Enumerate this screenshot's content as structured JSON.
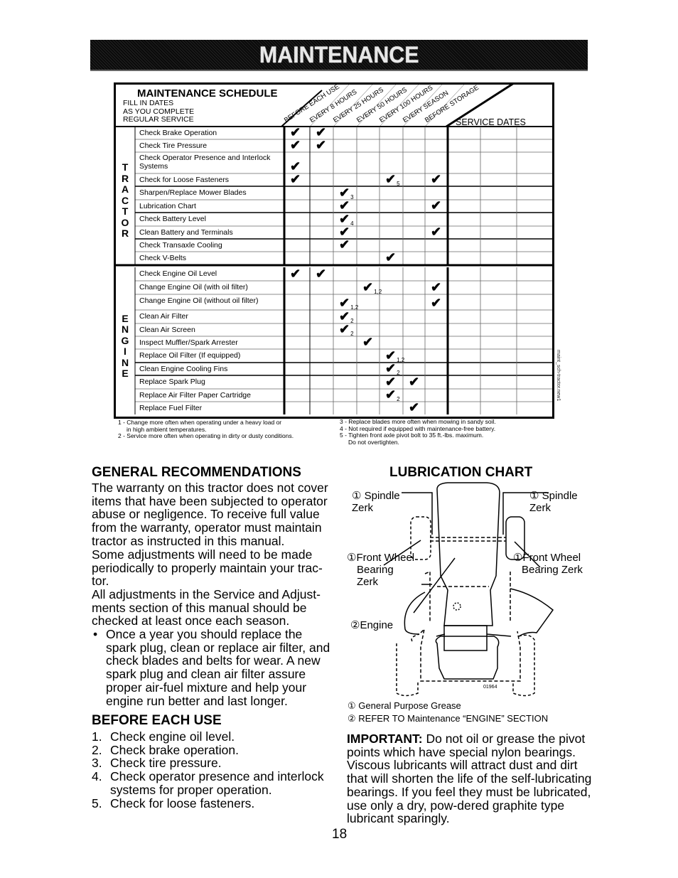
{
  "banner": {
    "title": "MAINTENANCE"
  },
  "schedule": {
    "title": "MAINTENANCE SCHEDULE",
    "subtitle_lines": [
      "FILL IN DATES",
      "AS YOU COMPLETE",
      "REGULAR SERVICE"
    ],
    "columns": [
      "BEFORE EACH USE",
      "EVERY 8 HOURS",
      "EVERY 25 HOURS",
      "EVERY 50 HOURS",
      "EVERY 100 HOURS",
      "EVERY SEASON",
      "BEFORE STORAGE"
    ],
    "service_dates_label": "SERVICE DATES",
    "service_date_columns": 3,
    "sections": [
      {
        "label": "TRACTOR",
        "tasks": [
          {
            "name": "Check Brake Operation",
            "checks": [
              {
                "col": 0
              },
              {
                "col": 1
              }
            ]
          },
          {
            "name": "Check Tire Pressure",
            "checks": [
              {
                "col": 0
              },
              {
                "col": 1
              }
            ]
          },
          {
            "name": "Check Operator Presence and Interlock Systems",
            "checks": [
              {
                "col": 0
              }
            ]
          },
          {
            "name": "Check for Loose Fasteners",
            "checks": [
              {
                "col": 0
              },
              {
                "col": 4,
                "note": "5"
              },
              {
                "col": 6
              }
            ]
          },
          {
            "name": "Sharpen/Replace Mower Blades",
            "checks": [
              {
                "col": 2,
                "note": "3"
              }
            ]
          },
          {
            "name": "Lubrication Chart",
            "checks": [
              {
                "col": 2
              },
              {
                "col": 6
              }
            ]
          },
          {
            "name": "Check Battery Level",
            "checks": [
              {
                "col": 2,
                "note": "4"
              }
            ]
          },
          {
            "name": "Clean Battery and Terminals",
            "checks": [
              {
                "col": 2
              },
              {
                "col": 6
              }
            ]
          },
          {
            "name": "Check Transaxle Cooling",
            "checks": [
              {
                "col": 2
              }
            ]
          },
          {
            "name": "Check V-Belts",
            "checks": [
              {
                "col": 4
              }
            ]
          }
        ]
      },
      {
        "label": "ENGINE",
        "tasks": [
          {
            "name": "Check Engine Oil Level",
            "checks": [
              {
                "col": 0
              },
              {
                "col": 1
              }
            ]
          },
          {
            "name": "Change Engine Oil (with oil filter)",
            "checks": [
              {
                "col": 3,
                "note": "1,2"
              },
              {
                "col": 6
              }
            ]
          },
          {
            "name": "Change Engine Oil (without oil filter)",
            "checks": [
              {
                "col": 2,
                "note": "1,2"
              },
              {
                "col": 6
              }
            ]
          },
          {
            "name": "Clean Air Filter",
            "checks": [
              {
                "col": 2,
                "note": "2"
              }
            ]
          },
          {
            "name": "Clean Air Screen",
            "checks": [
              {
                "col": 2,
                "note": "2"
              }
            ]
          },
          {
            "name": "Inspect Muffler/Spark Arrester",
            "checks": [
              {
                "col": 3
              }
            ]
          },
          {
            "name": "Replace Oil Filter (If equipped)",
            "checks": [
              {
                "col": 4,
                "note": "1,2"
              }
            ]
          },
          {
            "name": "Clean Engine Cooling Fins",
            "checks": [
              {
                "col": 4,
                "note": "2"
              }
            ]
          },
          {
            "name": "Replace Spark Plug",
            "checks": [
              {
                "col": 4
              },
              {
                "col": 5
              }
            ]
          },
          {
            "name": "Replace Air Filter Paper Cartridge",
            "checks": [
              {
                "col": 4,
                "note": "2"
              }
            ]
          },
          {
            "name": "Replace Fuel Filter",
            "checks": [
              {
                "col": 5
              }
            ]
          }
        ]
      }
    ],
    "footnotes_left": [
      "1 - Change more often when operating under a heavy load or",
      "in high ambient temperatures.",
      "2 - Service more often when operating in dirty or dusty conditions."
    ],
    "footnotes_right": [
      "3 - Replace blades more often when mowing in sandy soil.",
      "4 - Not required if equipped with maintenance-free battery.",
      "5 - Tighten front axle pivot bolt to 35 ft.-lbs. maximum.",
      "Do not overtighten."
    ],
    "file_id": "maint_sch-tractor.new1"
  },
  "general": {
    "heading": "GENERAL RECOMMENDATIONS",
    "paragraph1": "The warranty on this tractor does not cover items that have been subjected to operator abuse or negligence. To receive full value from the warranty, operator must maintain tractor as instructed in this manual.",
    "paragraph2": "Some adjustments will need to be made periodically to properly maintain your trac-tor.",
    "paragraph3": "All adjustments in the Service and Adjust-ments section of this manual should be checked at least once each season.",
    "bullet": "Once a year you should replace the spark plug, clean or replace air filter, and check blades and belts for wear. A new spark plug and clean air filter assure proper air-fuel mixture and help your engine run better and last longer."
  },
  "before_each_use": {
    "heading": "BEFORE EACH USE",
    "items": [
      "Check engine oil level.",
      "Check brake operation.",
      "Check tire pressure.",
      "Check operator presence and interlock systems for proper operation.",
      "Check for loose fasteners."
    ]
  },
  "lubrication": {
    "heading": "LUBRICATION CHART",
    "labels": {
      "spindle_left_1": "① Spindle",
      "spindle_left_2": "Zerk",
      "spindle_right_1": "① Spindle",
      "spindle_right_2": "Zerk",
      "fw_left_1": "①Front Wheel",
      "fw_left_2": "Bearing",
      "fw_left_3": "Zerk",
      "fw_right_1": "①Front Wheel",
      "fw_right_2": "Bearing Zerk",
      "engine": "②Engine",
      "figure_id": "01964"
    },
    "legend": [
      "① General Purpose Grease",
      "② REFER TO Maintenance  “ENGINE” SECTION"
    ],
    "important_label": "IMPORTANT:",
    "important_text": " Do not oil or grease the pivot points which have special nylon bearings. Viscous lubricants will attract dust and dirt that will shorten the life of the self-lubricating bearings. If you feel they must be lubricated, use only a dry, pow-dered graphite type lubricant sparingly."
  },
  "page_number": "18"
}
